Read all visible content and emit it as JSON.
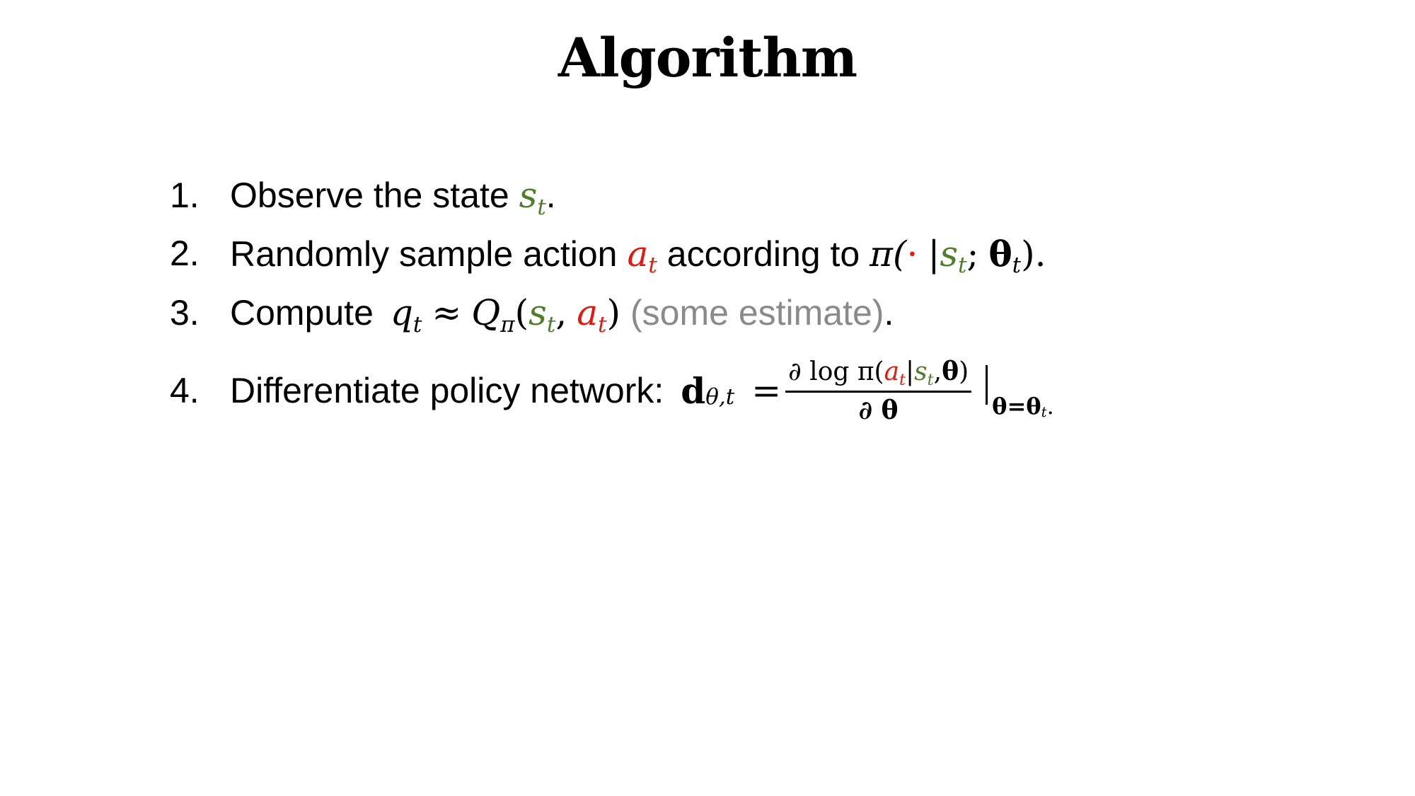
{
  "slide": {
    "title": "Algorithm"
  },
  "steps": [
    {
      "number": "1.",
      "text": "Observe the state",
      "state_var": "s",
      "state_sub": "t",
      "end": "."
    },
    {
      "number": "2.",
      "text": "Randomly sample action",
      "action_var": "a",
      "action_sub": "t",
      "text2": "according to",
      "pi": "π(",
      "dot": "·",
      "bar": "|",
      "state_var": "s",
      "state_sub": "t",
      "semi": ";",
      "theta": "θ",
      "theta_sub": "t",
      "close": ").",
      "end": ""
    },
    {
      "number": "3.",
      "text": "Compute",
      "q_var": "q",
      "q_sub": "t",
      "approx": "≈",
      "Q_var": "Q",
      "Q_sub": "π",
      "open": "(",
      "state_var": "s",
      "state_sub": "t",
      "comma": ",",
      "action_var": "a",
      "action_sub": "t",
      "close": ")",
      "note": "(some estimate)",
      "end": "."
    },
    {
      "number": "4.",
      "text": "Differentiate policy network:",
      "d_var": "d",
      "d_sub": "θ,t",
      "equals": "=",
      "frac_num_prefix": "∂ log π(",
      "frac_action": "a",
      "frac_action_sub": "t",
      "frac_bar": "|",
      "frac_state": "s",
      "frac_state_sub": "t",
      "frac_comma": ",",
      "frac_theta": "θ",
      "frac_close": ")",
      "frac_den": "∂ θ",
      "eval_sub": "θ=θ",
      "eval_sub_t": "t",
      "end": "."
    }
  ],
  "colors": {
    "state": "#4f7d2a",
    "action": "#e8170e",
    "note": "#8a8a8a",
    "text": "#000000"
  }
}
